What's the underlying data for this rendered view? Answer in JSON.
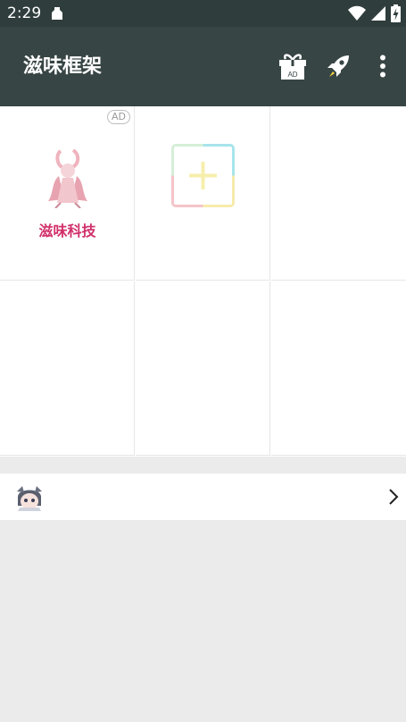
{
  "status_bar": {
    "time": "2:29",
    "icons": [
      "notification-bag-icon",
      "wifi-icon",
      "signal-icon",
      "battery-charging-icon"
    ]
  },
  "app_bar": {
    "title": "滋味框架",
    "actions": [
      "gift-ad-icon",
      "rocket-icon",
      "more-vert-icon"
    ],
    "gift_ad_badge": "AD"
  },
  "grid": {
    "cells": [
      {
        "type": "app",
        "label": "滋味科技",
        "badge": "AD",
        "icon": "pink-rabbit-girl-icon"
      },
      {
        "type": "add",
        "icon": "add-tile-icon"
      },
      {
        "type": "empty"
      },
      {
        "type": "empty"
      },
      {
        "type": "empty"
      },
      {
        "type": "empty"
      }
    ]
  },
  "list_row": {
    "avatar": "anime-avatar-icon",
    "chevron": "chevron-right-icon"
  },
  "colors": {
    "status_bar_bg": "#2f3d3c",
    "app_bar_bg": "#374544",
    "label_pink": "#d1306b",
    "page_bg": "#ebebeb"
  }
}
